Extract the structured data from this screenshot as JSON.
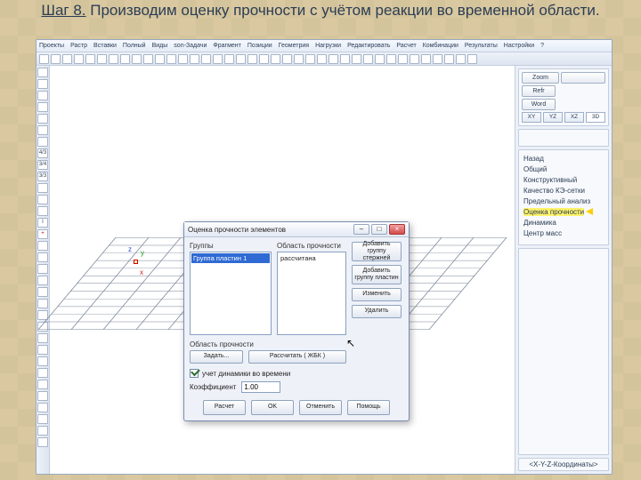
{
  "slide": {
    "step": "Шаг 8.",
    "title_rest": " Производим оценку прочности с учётом реакции во временной области."
  },
  "menubar": [
    "Проекты",
    "Растр",
    "Вставки",
    "Полный",
    "Виды",
    "son-Задачи",
    "Фрагмент",
    "Позиции",
    "Геометрия",
    "Нагрузки",
    "Редактировать",
    "Расчет",
    "Комбинации",
    "Результаты",
    "Настройки",
    "?"
  ],
  "axes": {
    "z": "z",
    "y": "y",
    "x": "x"
  },
  "right": {
    "zoom": "Zoom",
    "refr": "Refr",
    "word": "Word",
    "views": [
      "XY",
      "YZ",
      "XZ",
      "3D"
    ],
    "list": [
      "Назад",
      "Общий",
      "Конструктивный",
      "Качество КЭ-сетки",
      "Предельный анализ",
      "Оценка прочности",
      "Динамика",
      "Центр масс"
    ],
    "status": "<X-Y-Z-Координаты>"
  },
  "dialog": {
    "title": "Оценка прочности элементов",
    "groups_label": "Группы",
    "area_label": "Область прочности",
    "group_item": "Группа пластин 1",
    "area_item": "рассчитана",
    "btn_add_bars": "Добавить группу стержней",
    "btn_add_plates": "Добавить группу пластин",
    "btn_edit": "Изменить",
    "btn_delete": "Удалить",
    "area_section": "Область прочности",
    "btn_set": "Задать...",
    "btn_calc": "Рассчитать ( ЖБК )",
    "chk": "учет динамики во времени",
    "kf_label": "Коэффициент",
    "kf_value": "1.00",
    "foot": [
      "Расчет",
      "OK",
      "Отменить",
      "Помощь"
    ]
  }
}
